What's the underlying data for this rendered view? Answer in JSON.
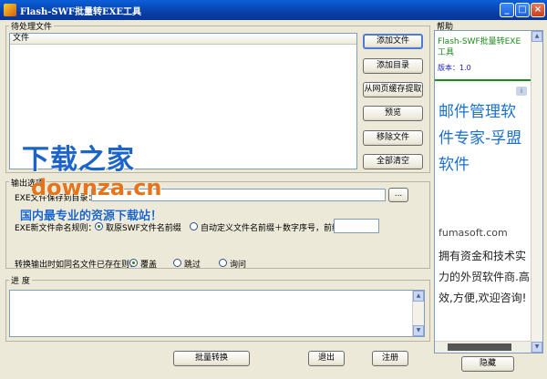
{
  "window": {
    "title": "Flash-SWF批量转EXE工具",
    "controls": {
      "minimize": "_",
      "maximize": "□",
      "close": "×"
    }
  },
  "pending_group": {
    "label": "待处理文件",
    "column_header": "文件"
  },
  "side_buttons": {
    "add_file": "添加文件",
    "add_folder": "添加目录",
    "extract_cache": "从网页缓存提取",
    "preview": "预览",
    "remove_file": "移除文件",
    "clear_all": "全部清空"
  },
  "output_group": {
    "label": "输出选项",
    "exe_dir_label": "EXE文件保存到目录：",
    "browse_label": "...",
    "naming_label": "EXE新文件命名规则：",
    "naming_option1": "取原SWF文件名前缀",
    "naming_option2": "自动定义文件名前缀＋数字序号，前缀：",
    "naming_prefix_value": "",
    "conflict_label": "转换输出时如同名文件已存在则：",
    "conflict_options": [
      "覆盖",
      "跳过",
      "询问"
    ]
  },
  "progress_group": {
    "label": "进  度"
  },
  "bottom_buttons": {
    "convert": "批量转换",
    "exit": "退出",
    "register": "注册"
  },
  "help": {
    "label": "帮助",
    "app_name": "Flash-SWF批量转EXE工具",
    "version_label": "版本：",
    "version_value": "1.0",
    "ad_headline": "邮件管理软件专家-孚盟软件",
    "ad_domain": "fumasoft.com",
    "ad_body": "拥有资金和技术实力的外贸软件商.高效,方便,欢迎咨询!",
    "hide_button": "隐藏"
  },
  "watermark": {
    "brand": "下载之家",
    "domain": "downza.cn",
    "slogan": "国内最专业的资源下载站！"
  },
  "colors": {
    "title_bar": "#0a5fd8",
    "help_title": "#1a8a1a",
    "help_version": "#1a1ab0",
    "ad_headline": "#1a6fd0",
    "watermark_blue": "#1c64c9",
    "watermark_orange": "#e8731a"
  }
}
